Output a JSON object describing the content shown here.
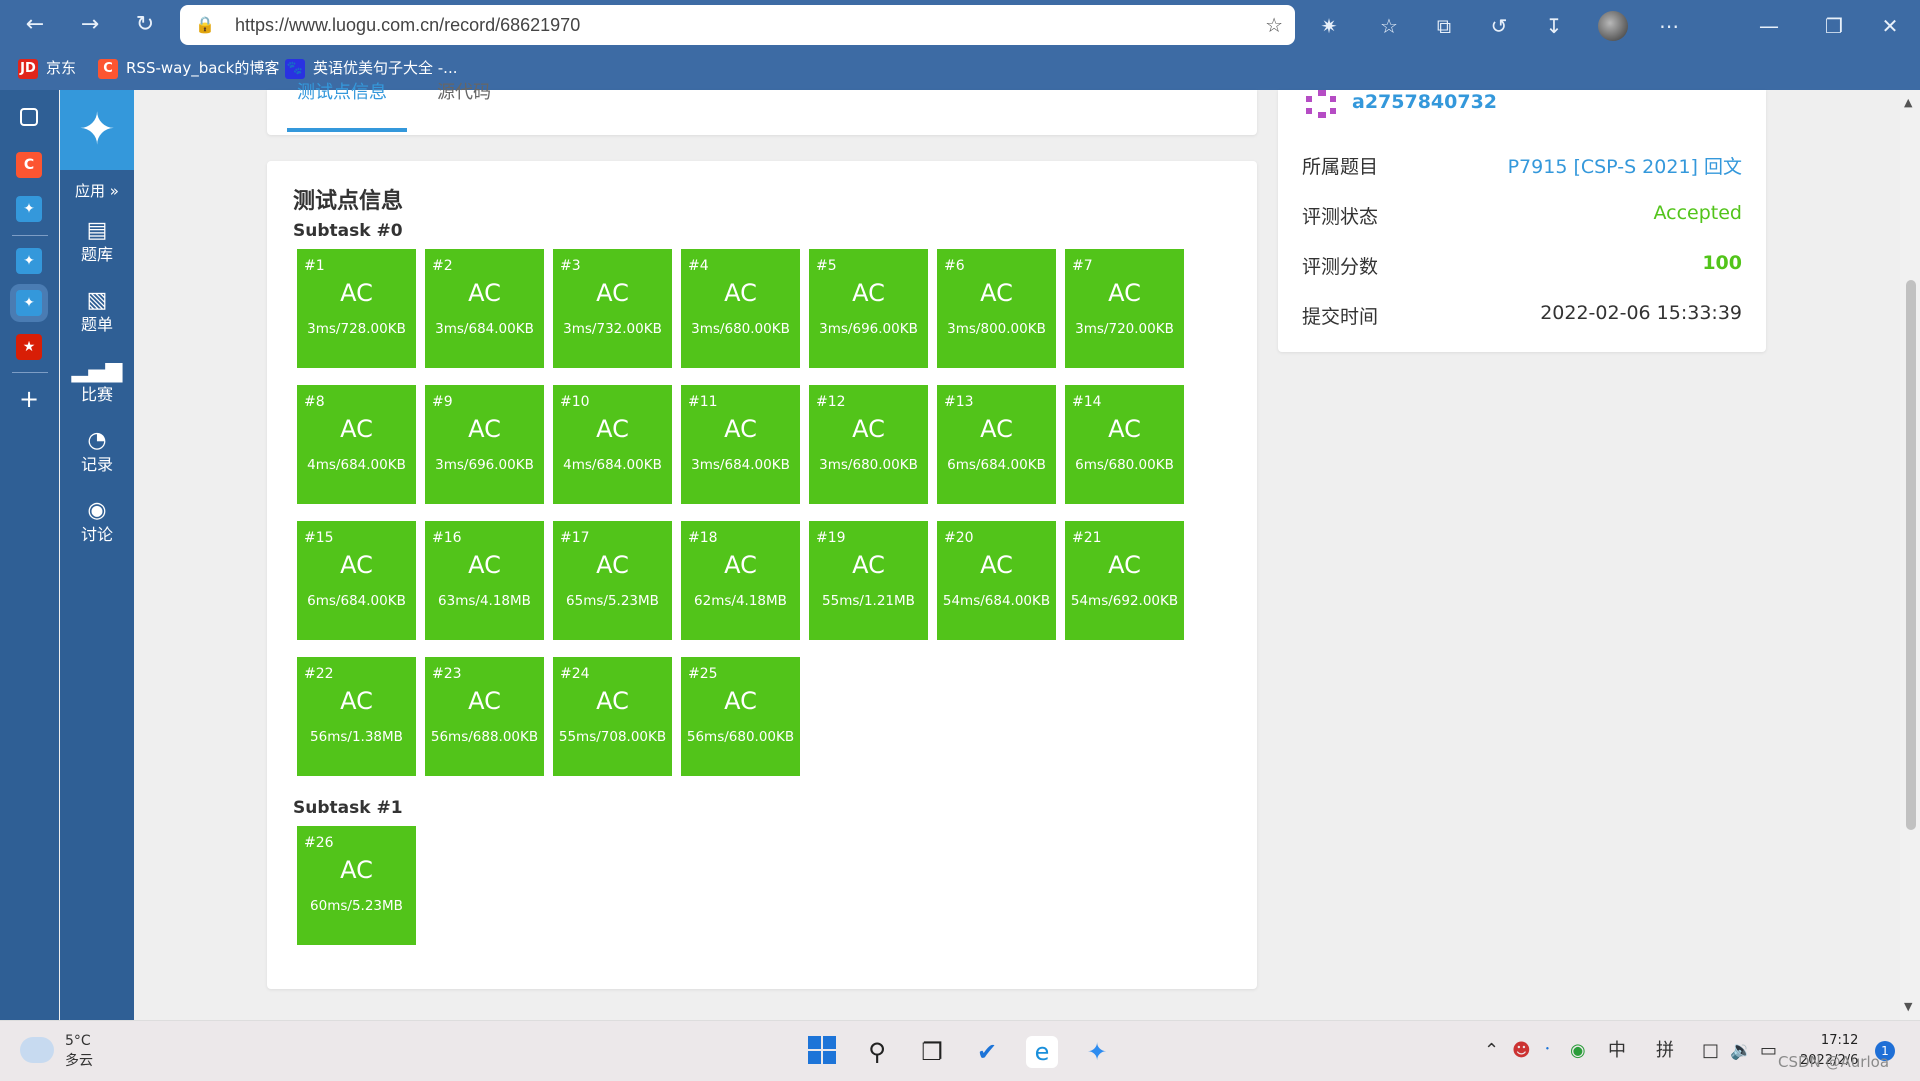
{
  "browser": {
    "url": "https://www.luogu.com.cn/record/68621970",
    "bookmarks": [
      {
        "icon": "JD",
        "label": "京东",
        "color": "#e1251b"
      },
      {
        "icon": "C",
        "label": "RSS-way_back的博客",
        "color": "#fc5531"
      },
      {
        "icon": "🐾",
        "label": "英语优美句子大全 -...",
        "color": "#2932e1"
      }
    ]
  },
  "nav": {
    "apps": "应用 »",
    "items": [
      "题库",
      "题单",
      "比赛",
      "记录",
      "讨论"
    ]
  },
  "tabs": [
    "测试点信息",
    "源代码"
  ],
  "main": {
    "title": "测试点信息",
    "subtasks": [
      {
        "name": "Subtask #0",
        "cases": [
          {
            "no": "#1",
            "status": "AC",
            "res": "3ms/728.00KB"
          },
          {
            "no": "#2",
            "status": "AC",
            "res": "3ms/684.00KB"
          },
          {
            "no": "#3",
            "status": "AC",
            "res": "3ms/732.00KB"
          },
          {
            "no": "#4",
            "status": "AC",
            "res": "3ms/680.00KB"
          },
          {
            "no": "#5",
            "status": "AC",
            "res": "3ms/696.00KB"
          },
          {
            "no": "#6",
            "status": "AC",
            "res": "3ms/800.00KB"
          },
          {
            "no": "#7",
            "status": "AC",
            "res": "3ms/720.00KB"
          },
          {
            "no": "#8",
            "status": "AC",
            "res": "4ms/684.00KB"
          },
          {
            "no": "#9",
            "status": "AC",
            "res": "3ms/696.00KB"
          },
          {
            "no": "#10",
            "status": "AC",
            "res": "4ms/684.00KB"
          },
          {
            "no": "#11",
            "status": "AC",
            "res": "3ms/684.00KB"
          },
          {
            "no": "#12",
            "status": "AC",
            "res": "3ms/680.00KB"
          },
          {
            "no": "#13",
            "status": "AC",
            "res": "6ms/684.00KB"
          },
          {
            "no": "#14",
            "status": "AC",
            "res": "6ms/680.00KB"
          },
          {
            "no": "#15",
            "status": "AC",
            "res": "6ms/684.00KB"
          },
          {
            "no": "#16",
            "status": "AC",
            "res": "63ms/4.18MB"
          },
          {
            "no": "#17",
            "status": "AC",
            "res": "65ms/5.23MB"
          },
          {
            "no": "#18",
            "status": "AC",
            "res": "62ms/4.18MB"
          },
          {
            "no": "#19",
            "status": "AC",
            "res": "55ms/1.21MB"
          },
          {
            "no": "#20",
            "status": "AC",
            "res": "54ms/684.00KB"
          },
          {
            "no": "#21",
            "status": "AC",
            "res": "54ms/692.00KB"
          },
          {
            "no": "#22",
            "status": "AC",
            "res": "56ms/1.38MB"
          },
          {
            "no": "#23",
            "status": "AC",
            "res": "56ms/688.00KB"
          },
          {
            "no": "#24",
            "status": "AC",
            "res": "55ms/708.00KB"
          },
          {
            "no": "#25",
            "status": "AC",
            "res": "56ms/680.00KB"
          }
        ]
      },
      {
        "name": "Subtask #1",
        "cases": [
          {
            "no": "#26",
            "status": "AC",
            "res": "60ms/5.23MB"
          }
        ]
      }
    ]
  },
  "info": {
    "username": "a2757840732",
    "rows": [
      {
        "key": "所属题目",
        "value": "P7915 [CSP-S 2021] 回文",
        "color": "#3498db",
        "bold": false
      },
      {
        "key": "评测状态",
        "value": "Accepted",
        "color": "#52c41a",
        "bold": false
      },
      {
        "key": "评测分数",
        "value": "100",
        "color": "#52c41a",
        "bold": true
      },
      {
        "key": "提交时间",
        "value": "2022-02-06 15:33:39",
        "color": "#333333",
        "bold": false
      }
    ]
  },
  "taskbar": {
    "temp": "5°C",
    "weather": "多云",
    "ime1": "中",
    "ime2": "拼",
    "time": "17:12",
    "date": "2022/2/6",
    "notif": "1"
  },
  "watermark": "CSDN @Aurloa",
  "colors": {
    "ac": "#52c41a",
    "accent": "#3498db",
    "chrome": "#3d6ba4"
  }
}
